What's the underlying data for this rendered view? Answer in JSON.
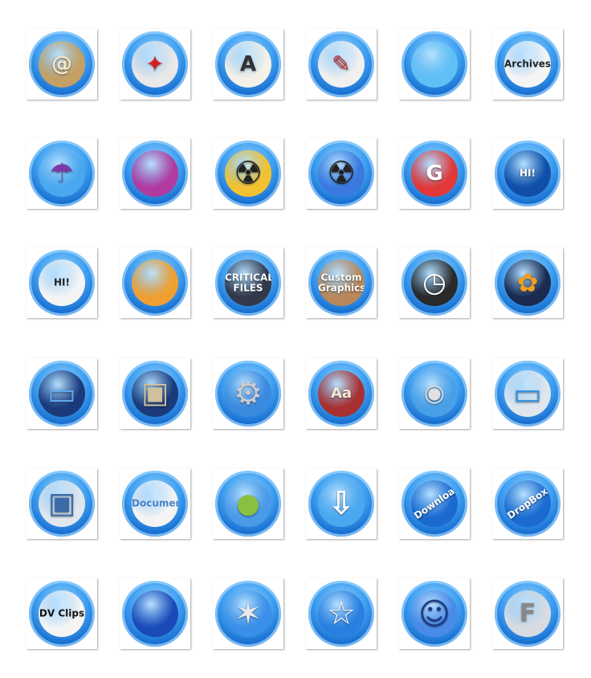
{
  "icons": [
    {
      "name": "address-book",
      "glyph": "@",
      "caption": "",
      "color": "#c4a064",
      "fg": "#f6e7c8",
      "size": 26
    },
    {
      "name": "acrobat",
      "glyph": "✦",
      "caption": "",
      "color": "#e8e8e8",
      "fg": "#d42020",
      "size": 28
    },
    {
      "name": "text-edit",
      "glyph": "A",
      "caption": "",
      "color": "#f4f1e8",
      "fg": "#333333",
      "size": 26
    },
    {
      "name": "pencil-cup",
      "glyph": "✎",
      "caption": "",
      "color": "#f0f0f0",
      "fg": "#c03030",
      "size": 28
    },
    {
      "name": "blank-blue",
      "glyph": "",
      "caption": "",
      "color": "#5fc0f5",
      "fg": "#ffffff",
      "size": 10
    },
    {
      "name": "archives-clock",
      "glyph": "",
      "caption": "Archives",
      "color": "#f5f5f5",
      "fg": "#222222",
      "size": 10
    },
    {
      "name": "umbrella",
      "glyph": "☂",
      "caption": "",
      "color": "#4aa8f0",
      "fg": "#7a3aa8",
      "size": 34
    },
    {
      "name": "blank-pink",
      "glyph": "",
      "caption": "",
      "color": "#b03aa0",
      "fg": "#ffffff",
      "size": 10
    },
    {
      "name": "radiation-yellow",
      "glyph": "☢",
      "caption": "",
      "color": "#f2c230",
      "fg": "#222222",
      "size": 40
    },
    {
      "name": "radiation-blue",
      "glyph": "☢",
      "caption": "",
      "color": "#3a7ae0",
      "fg": "#222222",
      "size": 40
    },
    {
      "name": "gmail-card",
      "glyph": "G",
      "caption": "",
      "color": "#e23838",
      "fg": "#ffffff",
      "size": 26
    },
    {
      "name": "hi-bubble-blue",
      "glyph": "",
      "caption": "HI!",
      "color": "#0f4fa8",
      "fg": "#ffffff",
      "size": 10
    },
    {
      "name": "hi-bubble-white",
      "glyph": "",
      "caption": "HI!",
      "color": "#f4f4f4",
      "fg": "#222222",
      "size": 10
    },
    {
      "name": "apple-rainbow",
      "glyph": "",
      "caption": "",
      "color": "#f0a030",
      "fg": "#ffffff",
      "size": 10
    },
    {
      "name": "critical-files",
      "glyph": "",
      "caption": "CRITICAL FILES",
      "color": "#33384a",
      "fg": "#ffffff",
      "size": 10
    },
    {
      "name": "custom-graphics",
      "glyph": "",
      "caption": "Custom Graphics",
      "color": "#b8875a",
      "fg": "#ffffff",
      "size": 10
    },
    {
      "name": "dashboard",
      "glyph": "◷",
      "caption": "",
      "color": "#2a2a2a",
      "fg": "#ffffff",
      "size": 34
    },
    {
      "name": "photo-frame",
      "glyph": "✿",
      "caption": "",
      "color": "#1a2a50",
      "fg": "#f0a020",
      "size": 32
    },
    {
      "name": "display-blue",
      "glyph": "▭",
      "caption": "",
      "color": "#1a3a7a",
      "fg": "#5fa8f0",
      "size": 38
    },
    {
      "name": "display-photos",
      "glyph": "▣",
      "caption": "",
      "color": "#1a3a7a",
      "fg": "#d0c0a0",
      "size": 36
    },
    {
      "name": "gears",
      "glyph": "⚙",
      "caption": "",
      "color": "#3a8ae0",
      "fg": "#c8ccd4",
      "size": 40
    },
    {
      "name": "dictionary",
      "glyph": "Aa",
      "caption": "",
      "color": "#a83030",
      "fg": "#f4e8d0",
      "size": 18
    },
    {
      "name": "smile-dvd",
      "glyph": "◉",
      "caption": "",
      "color": "#4aa0e8",
      "fg": "#e0e0e0",
      "size": 30
    },
    {
      "name": "imac-display",
      "glyph": "▭",
      "caption": "",
      "color": "#dfe6ee",
      "fg": "#3a90e0",
      "size": 38
    },
    {
      "name": "imac-photos",
      "glyph": "▣",
      "caption": "",
      "color": "#e0e6ee",
      "fg": "#3a6aa8",
      "size": 36
    },
    {
      "name": "document",
      "glyph": "",
      "caption": "Document",
      "color": "#f4f4f4",
      "fg": "#4a80c8",
      "size": 10
    },
    {
      "name": "green-apples",
      "glyph": "●",
      "caption": "",
      "color": "#4a9ae8",
      "fg": "#8ac040",
      "size": 34
    },
    {
      "name": "download-arrow",
      "glyph": "⇩",
      "caption": "",
      "color": "#4aa8f0",
      "fg": "#ffffff",
      "size": 40
    },
    {
      "name": "downloads",
      "glyph": "",
      "caption": "Downloads",
      "color": "#1a6ad0",
      "fg": "#ffffff",
      "size": 10
    },
    {
      "name": "dropbox",
      "glyph": "",
      "caption": "DropBox",
      "color": "#1a6ad0",
      "fg": "#ffffff",
      "size": 10
    },
    {
      "name": "dv-clips",
      "glyph": "",
      "caption": "DV Clips",
      "color": "#f4f4f4",
      "fg": "#111111",
      "size": 10
    },
    {
      "name": "blue-cat",
      "glyph": "",
      "caption": "",
      "color": "#1a4ab8",
      "fg": "#ffffff",
      "size": 10
    },
    {
      "name": "silver-star-six",
      "glyph": "✶",
      "caption": "",
      "color": "#3a90e8",
      "fg": "#e8e8ee",
      "size": 40
    },
    {
      "name": "star-outline",
      "glyph": "☆",
      "caption": "",
      "color": "#2a80e0",
      "fg": "#ffffff",
      "size": 40
    },
    {
      "name": "finder",
      "glyph": "☺",
      "caption": "",
      "color": "#4a8ae8",
      "fg": "#1a3a88",
      "size": 38
    },
    {
      "name": "font-file",
      "glyph": "F",
      "caption": "",
      "color": "#d8dce2",
      "fg": "#888888",
      "size": 30
    }
  ]
}
